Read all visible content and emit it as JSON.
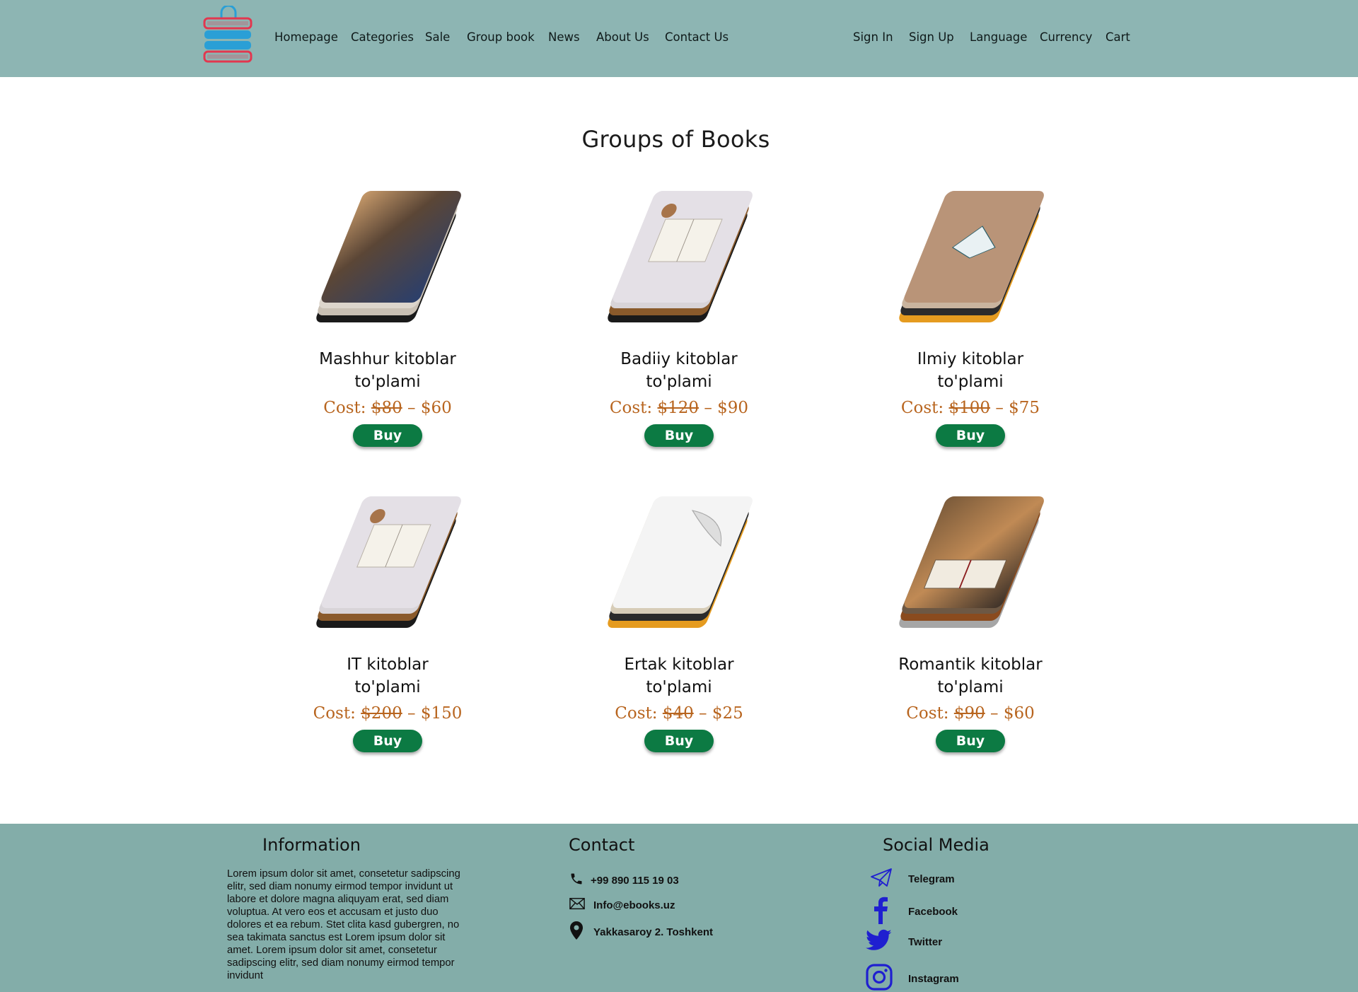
{
  "header": {
    "nav_left": [
      "Homepage",
      "Categories",
      "Sale",
      "Group book",
      "News",
      "About Us",
      "Contact Us"
    ],
    "nav_right": [
      "Sign In",
      "Sign Up",
      "Language",
      "Currency",
      "Cart"
    ]
  },
  "main": {
    "title": "Groups of Books",
    "cost_label": "Cost:",
    "buy_label": "Buy",
    "cards": [
      {
        "title_line1": "Mashhur kitoblar",
        "title_line2": "to'plami",
        "old_price": "$80",
        "new_price": "$60",
        "cover": "library"
      },
      {
        "title_line1": "Badiiy kitoblar",
        "title_line2": "to'plami",
        "old_price": "$120",
        "new_price": "$90",
        "cover": "open-book-coffee"
      },
      {
        "title_line1": "Ilmiy kitoblar",
        "title_line2": "to'plami",
        "old_price": "$100",
        "new_price": "$75",
        "cover": "folded-book"
      },
      {
        "title_line1": "IT kitoblar",
        "title_line2": "to'plami",
        "old_price": "$200",
        "new_price": "$150",
        "cover": "open-book-coffee"
      },
      {
        "title_line1": "Ertak kitoblar",
        "title_line2": "to'plami",
        "old_price": "$40",
        "new_price": "$25",
        "cover": "white-pages"
      },
      {
        "title_line1": "Romantik kitoblar",
        "title_line2": "to'plami",
        "old_price": "$90",
        "new_price": "$60",
        "cover": "open-book-bokeh"
      }
    ]
  },
  "footer": {
    "information": {
      "heading": "Information",
      "text": "Lorem ipsum dolor sit amet, consetetur sadipscing elitr, sed diam nonumy eirmod tempor invidunt ut labore et dolore magna aliquyam erat, sed diam voluptua. At vero eos et accusam et justo duo dolores et ea rebum. Stet clita kasd gubergren, no sea takimata sanctus est Lorem ipsum dolor sit amet. Lorem ipsum dolor sit amet, consetetur sadipscing elitr, sed diam nonumy eirmod tempor invidunt"
    },
    "contact": {
      "heading": "Contact",
      "phone": "+99 890 115 19 03",
      "email": "Info@ebooks.uz",
      "address": "Yakkasaroy 2. Toshkent"
    },
    "social": {
      "heading": "Social Media",
      "items": [
        "Telegram",
        "Facebook",
        "Twitter",
        "Instagram"
      ]
    }
  },
  "colors": {
    "header_bg": "#8db5b3",
    "footer_bg": "#83ada9",
    "price": "#b8651f",
    "buy_button": "#0c7a43",
    "social_icon": "#1f1fd0"
  }
}
